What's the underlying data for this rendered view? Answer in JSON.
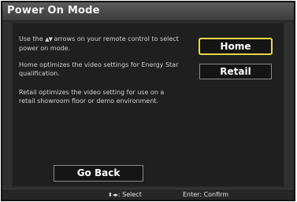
{
  "screen": {
    "title": "Power On Mode"
  },
  "description": {
    "line1_pre": "Use the",
    "arrows_glyph": "▲▼",
    "line1_post": "arrows on your remote control to select power on mode.",
    "home_text": "Home optimizes the video settings for Energy Star qualification.",
    "retail_text": "Retail optimizes the video setting for use on a retail showroom floor or demo environment."
  },
  "options": {
    "home_label": "Home",
    "retail_label": "Retail",
    "selected": "Home"
  },
  "go_back_label": "Go Back",
  "footer": {
    "nav_glyph": "⬍◂▸",
    "select_label": ": Select",
    "confirm_label": "Enter: Confirm"
  },
  "colors": {
    "selection_border": "#e8d84a",
    "background": "#2f2f2f",
    "panel": "#1f1f1f"
  }
}
